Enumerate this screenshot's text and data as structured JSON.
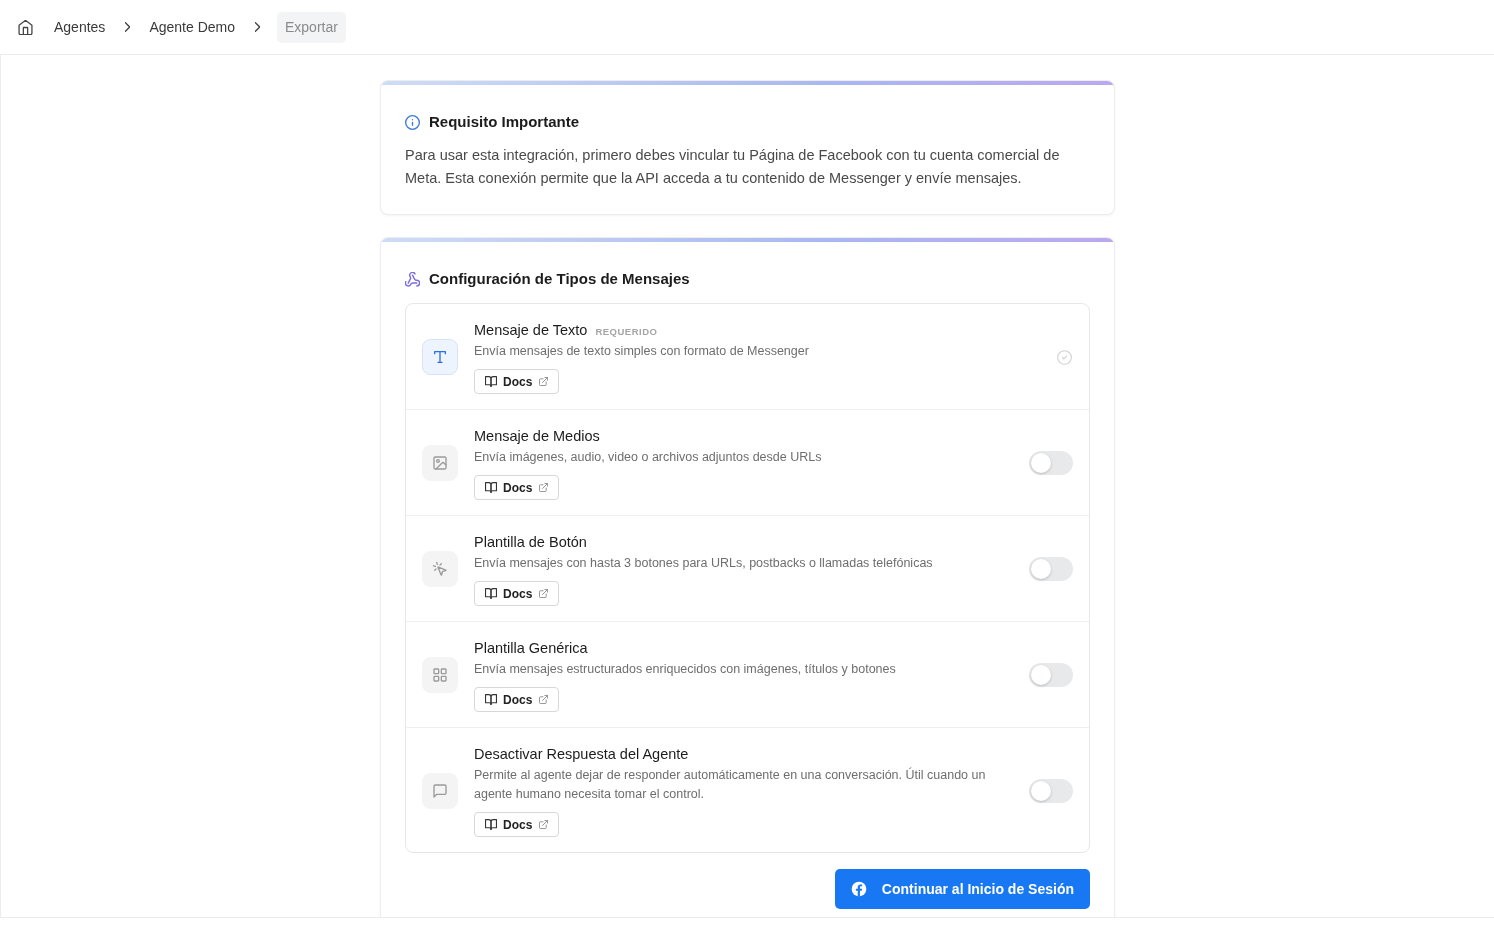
{
  "breadcrumb": [
    {
      "label": "Agentes",
      "current": false
    },
    {
      "label": "Agente Demo",
      "current": false
    },
    {
      "label": "Exportar",
      "current": true
    }
  ],
  "notice": {
    "title": "Requisito Importante",
    "text": "Para usar esta integración, primero debes vincular tu Página de Facebook con tu cuenta comercial de Meta. Esta conexión permite que la API acceda a tu contenido de Messenger y envíe mensajes."
  },
  "message_config": {
    "title": "Configuración de Tipos de Mensajes",
    "items": [
      {
        "kind": "required",
        "title": "Mensaje de Texto",
        "badge": "REQUERIDO",
        "description": "Envía mensajes de texto simples con formato de Messenger",
        "docs_label": "Docs"
      },
      {
        "kind": "toggle",
        "title": "Mensaje de Medios",
        "description": "Envía imágenes, audio, video o archivos adjuntos desde URLs",
        "docs_label": "Docs",
        "on": false
      },
      {
        "kind": "toggle",
        "title": "Plantilla de Botón",
        "description": "Envía mensajes con hasta 3 botones para URLs, postbacks o llamadas telefónicas",
        "docs_label": "Docs",
        "on": false
      },
      {
        "kind": "toggle",
        "title": "Plantilla Genérica",
        "description": "Envía mensajes estructurados enriquecidos con imágenes, títulos y botones",
        "docs_label": "Docs",
        "on": false
      },
      {
        "kind": "toggle",
        "title": "Desactivar Respuesta del Agente",
        "description": "Permite al agente dejar de responder automáticamente en una conversación. Útil cuando un agente humano necesita tomar el control.",
        "docs_label": "Docs",
        "on": false
      }
    ],
    "continue_button": "Continuar al Inicio de Sesión"
  }
}
